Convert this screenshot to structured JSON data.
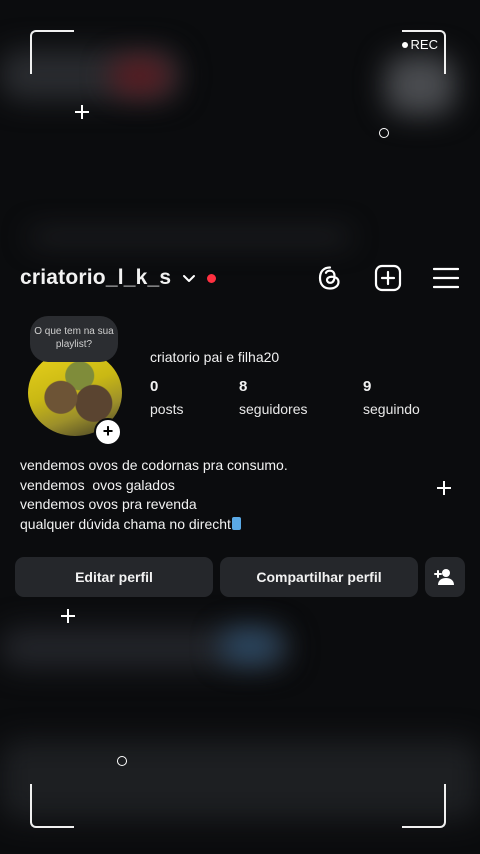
{
  "recording": {
    "label": "REC"
  },
  "profile": {
    "username": "criatorio_l_k_s",
    "full_name": "criatorio pai e filha20",
    "note_placeholder": "O que tem na sua playlist?",
    "stats": [
      {
        "value": "0",
        "label": "posts"
      },
      {
        "value": "8",
        "label": "seguidores"
      },
      {
        "value": "9",
        "label": "seguindo"
      }
    ],
    "bio": [
      "vendemos ovos de codornas pra consumo.",
      "vendemos  ovos galados",
      "vendemos ovos pra revenda",
      "qualquer dúvida chama no direcht"
    ]
  },
  "actions": {
    "edit_profile": "Editar perfil",
    "share_profile": "Compartilhar perfil"
  },
  "icons": {
    "threads": "threads-icon",
    "create": "create-post-icon",
    "menu": "hamburger-menu-icon",
    "add_user": "add-user-icon"
  },
  "colors": {
    "background": "#0b0c0e",
    "button": "#25272b",
    "live_dot": "#ff3040"
  }
}
